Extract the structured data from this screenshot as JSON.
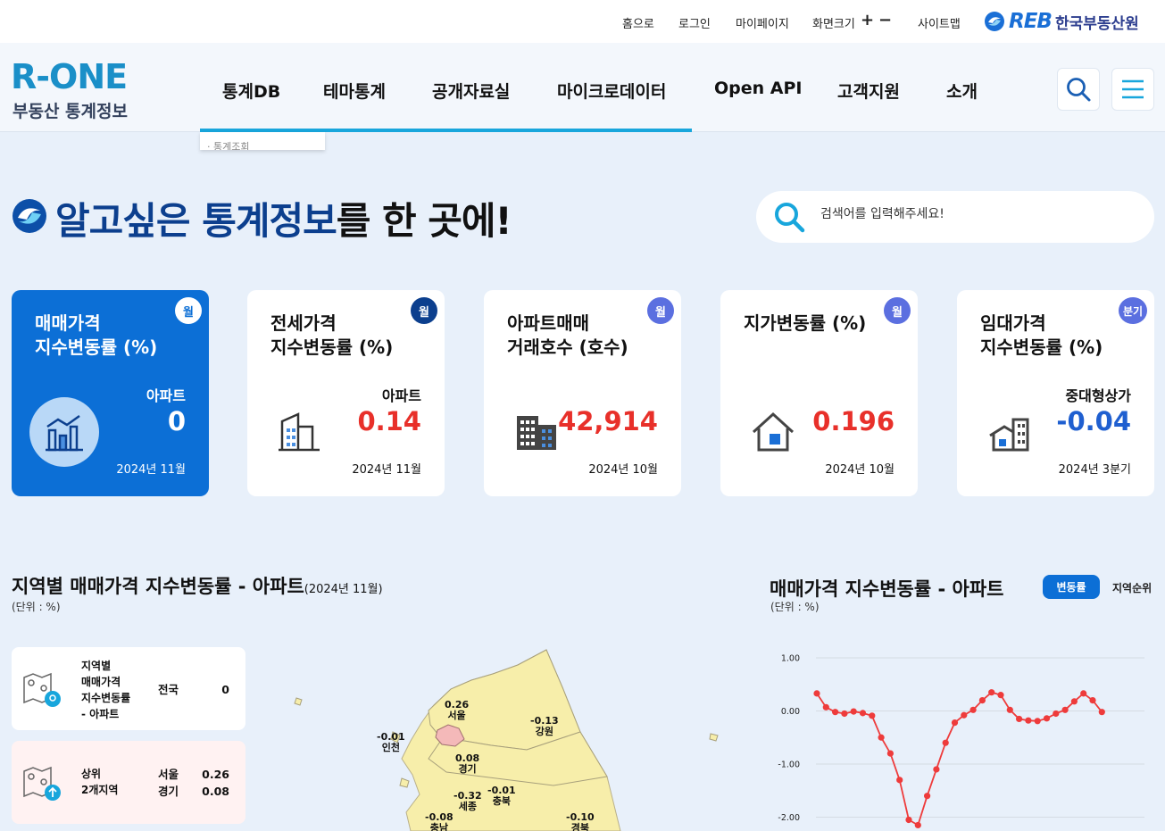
{
  "utility": {
    "home": "홈으로",
    "login": "로그인",
    "mypage": "마이페이지",
    "screen_size": "화면크기",
    "sitemap": "사이트맵",
    "reb_mark": "REB",
    "reb_name": "한국부동산원"
  },
  "logo": {
    "main": "R-ONE",
    "sub": "부동산 통계정보"
  },
  "nav": {
    "items": [
      "통계DB",
      "테마통계",
      "공개자료실",
      "마이크로데이터",
      "Open API",
      "고객지원",
      "소개"
    ],
    "dropdown_first": "· 통계조회"
  },
  "hero": {
    "title_prefix": "알고싶은 ",
    "title_highlight": "통계정보",
    "title_suffix": "를 한 곳에!",
    "search_placeholder": "검색어를 입력해주세요!"
  },
  "cards": [
    {
      "title": "매매가격\n지수변동률 (%)",
      "badge": "월",
      "sub": "아파트",
      "value": "0",
      "date": "2024년 11월",
      "icon": "chart-bar-icon"
    },
    {
      "title": "전세가격\n지수변동률 (%)",
      "badge": "월",
      "sub": "아파트",
      "value": "0.14",
      "date": "2024년 11월",
      "icon": "building-icon"
    },
    {
      "title": "아파트매매\n거래호수 (호수)",
      "badge": "월",
      "sub": "",
      "value": "42,914",
      "date": "2024년 10월",
      "icon": "apartment-icon"
    },
    {
      "title": "지가변동률 (%)",
      "badge": "월",
      "sub": "",
      "value": "0.196",
      "date": "2024년 10월",
      "icon": "house-icon"
    },
    {
      "title": "임대가격\n지수변동률 (%)",
      "badge": "분기",
      "sub": "중대형상가",
      "value": "-0.04",
      "date": "2024년 3분기",
      "icon": "store-icon"
    }
  ],
  "colors": {
    "primary": "#0c6fd6",
    "navy": "#0c3f8e",
    "positive": "#e8302a",
    "negative": "#1f5fd0",
    "accent": "#18a6dc"
  },
  "regional": {
    "title": "지역별 매매가격 지수변동률 - 아파트",
    "period": "(2024년 11월)",
    "unit": "(단위 : %)",
    "panel1": {
      "label": "지역별\n매매가격\n지수변동률\n- 아파트",
      "region": "전국",
      "value": "0"
    },
    "panel2": {
      "label": "상위\n2개지역",
      "regions": [
        "서울",
        "경기"
      ],
      "values": [
        "0.26",
        "0.08"
      ]
    },
    "map_labels": [
      {
        "value": "0.26",
        "name": "서울"
      },
      {
        "value": "-0.01",
        "name": "인천"
      },
      {
        "value": "-0.13",
        "name": "강원"
      },
      {
        "value": "0.08",
        "name": "경기"
      },
      {
        "value": "-0.32",
        "name": "세종"
      },
      {
        "value": "-0.01",
        "name": "충북"
      },
      {
        "value": "-0.08",
        "name": "충남"
      },
      {
        "value": "-0.10",
        "name": "경북"
      }
    ]
  },
  "trend": {
    "title": "매매가격 지수변동률 - 아파트",
    "unit": "(단위 : %)",
    "toggle_active": "변동률",
    "toggle_inactive": "지역순위"
  },
  "chart_data": {
    "type": "line",
    "title": "매매가격 지수변동률 - 아파트",
    "ylabel": "(단위 : %)",
    "ylim": [
      -2.0,
      1.0
    ],
    "yticks": [
      "1.00",
      "0.00",
      "-1.00",
      "-2.00"
    ],
    "grid": true,
    "series": [
      {
        "values": [
          0.33,
          0.07,
          -0.02,
          -0.05,
          -0.01,
          -0.04,
          -0.09,
          -0.5,
          -0.8,
          -1.3,
          -2.05,
          -2.15,
          -1.6,
          -1.1,
          -0.6,
          -0.22,
          -0.08,
          0.02,
          0.2,
          0.35,
          0.3,
          0.02,
          -0.15,
          -0.18,
          -0.19,
          -0.14,
          -0.05,
          0.02,
          0.18,
          0.33,
          0.2,
          -0.02
        ]
      }
    ]
  }
}
